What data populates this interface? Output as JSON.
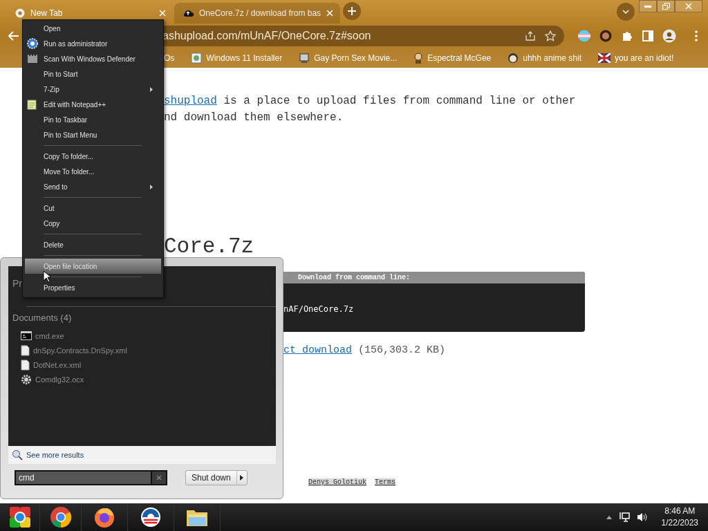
{
  "browser": {
    "tabs": [
      {
        "title": "New Tab",
        "selected": false
      },
      {
        "title": "OneCore.7z / download from bas",
        "selected": true
      }
    ],
    "address": "ashupload.com/mUnAF/OneCore.7z#soon",
    "bookmarks": [
      "Os",
      "Windows 11 Installer",
      "Gay Porn Sex Movie...",
      "Espectral McGee",
      "uhhh anime shit",
      "you are an idiot!"
    ],
    "page": {
      "intro_link": "shupload",
      "intro_text": " is a place to upload files from command line or other nd download them elsewhere.",
      "heading": "Core.7z",
      "command_box": {
        "title": "Download from command line:",
        "command": "nAF/OneCore.7z"
      },
      "download_link": "ct download",
      "download_size": "(156,303.2 KB)",
      "footer_links": [
        "Denys Golotiuk",
        "Terms"
      ]
    }
  },
  "start_menu": {
    "programs_header": "Pr",
    "documents_header": "Documents (4)",
    "documents": [
      {
        "name": "cmd.exe",
        "kind": "terminal"
      },
      {
        "name": "dnSpy.Contracts.DnSpy.xml",
        "kind": "document"
      },
      {
        "name": "DotNet.ex.xml",
        "kind": "document"
      },
      {
        "name": "Comdlg32.ocx",
        "kind": "settings"
      }
    ],
    "see_more": "See more results",
    "search": {
      "value": "cmd"
    },
    "shutdown": "Shut down"
  },
  "context_menu": [
    {
      "kind": "item",
      "label": "Open",
      "submenu": false,
      "selected": false
    },
    {
      "kind": "item",
      "label": "Run as administrator",
      "submenu": false,
      "selected": false
    },
    {
      "kind": "item",
      "label": "Scan With Windows Defender",
      "submenu": false,
      "selected": false
    },
    {
      "kind": "item",
      "label": "Pin to Start",
      "submenu": false,
      "selected": false
    },
    {
      "kind": "item",
      "label": "7-Zip",
      "submenu": true,
      "selected": false
    },
    {
      "kind": "item",
      "label": "Edit with Notepad++",
      "submenu": false,
      "selected": false
    },
    {
      "kind": "item",
      "label": "Pin to Taskbar",
      "submenu": false,
      "selected": false
    },
    {
      "kind": "item",
      "label": "Pin to Start Menu",
      "submenu": false,
      "selected": false
    },
    {
      "kind": "separator"
    },
    {
      "kind": "item",
      "label": "Copy To folder...",
      "submenu": false,
      "selected": false
    },
    {
      "kind": "item",
      "label": "Move To folder...",
      "submenu": false,
      "selected": false
    },
    {
      "kind": "item",
      "label": "Send to",
      "submenu": true,
      "selected": false
    },
    {
      "kind": "separator"
    },
    {
      "kind": "item",
      "label": "Cut",
      "submenu": false,
      "selected": false
    },
    {
      "kind": "item",
      "label": "Copy",
      "submenu": false,
      "selected": false
    },
    {
      "kind": "separator"
    },
    {
      "kind": "item",
      "label": "Delete",
      "submenu": false,
      "selected": false
    },
    {
      "kind": "separator"
    },
    {
      "kind": "item",
      "label": "Open file location",
      "submenu": false,
      "selected": true
    },
    {
      "kind": "separator"
    },
    {
      "kind": "item",
      "label": "Properties",
      "submenu": false,
      "selected": false
    }
  ],
  "taskbar": {
    "time": "8:46 AM",
    "date": "1/22/2023"
  }
}
